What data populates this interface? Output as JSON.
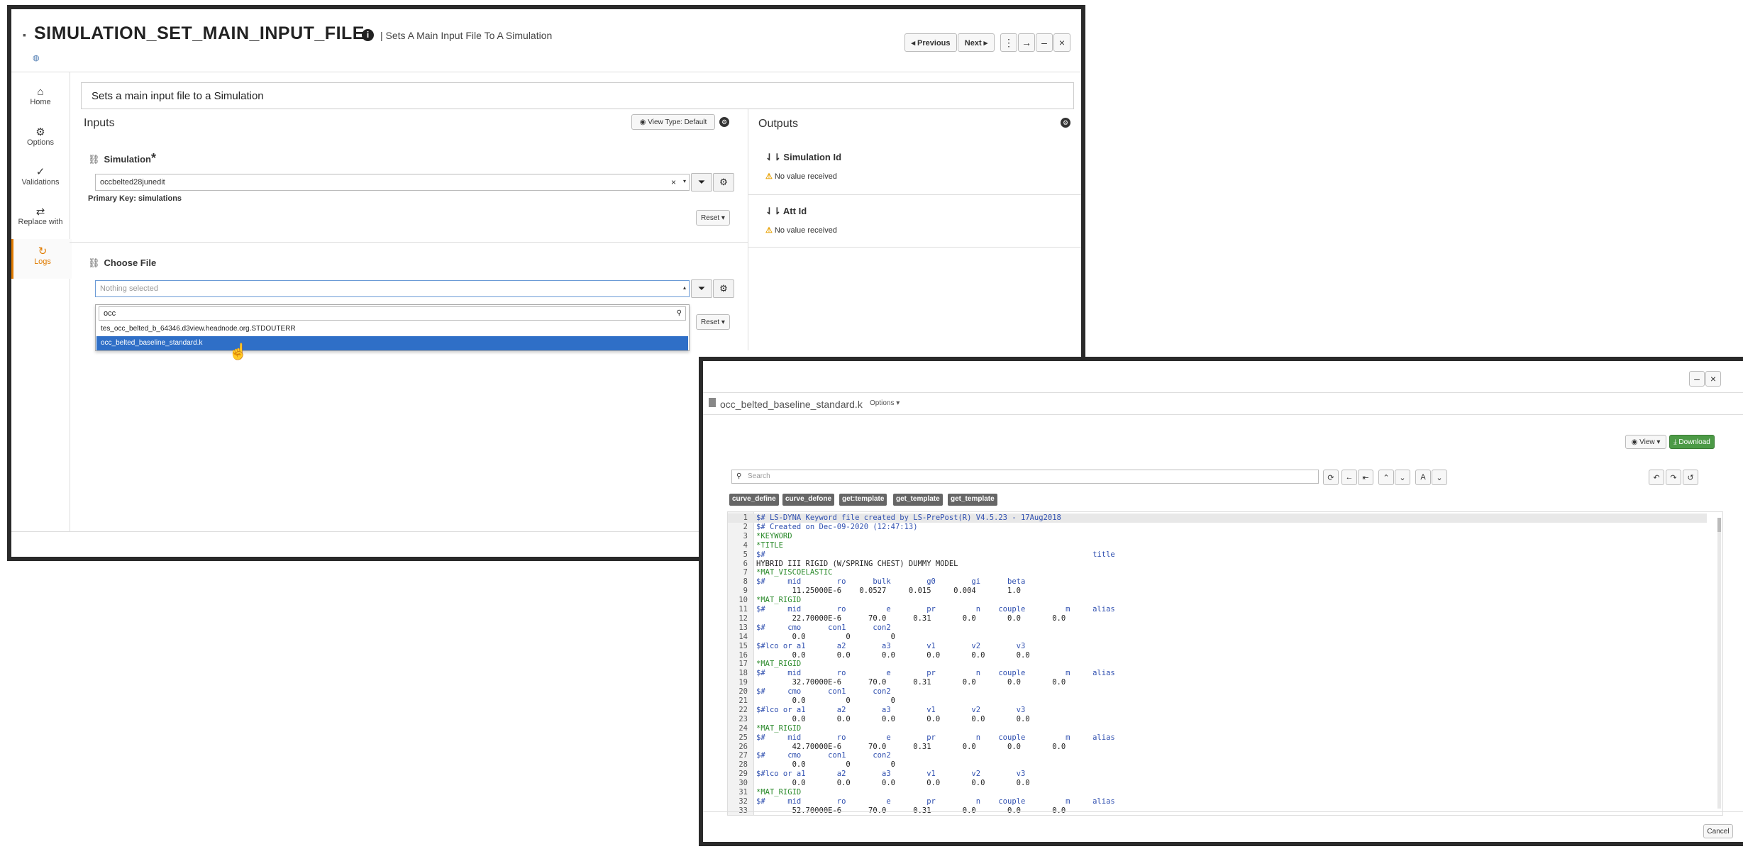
{
  "main_window": {
    "title": "SIMULATION_SET_MAIN_INPUT_FILE",
    "info_icon": "i",
    "subtitle": "| Sets A Main Input File To A Simulation",
    "nav": {
      "previous": "◂ Previous",
      "next": "Next ▸"
    },
    "window_controls": {
      "more": "⋮",
      "forward": "→",
      "minimize": "–",
      "close": "×"
    },
    "sidebar": [
      {
        "icon": "⌂",
        "label": "Home"
      },
      {
        "icon": "⚙",
        "label": "Options"
      },
      {
        "icon": "✓",
        "label": "Validations"
      },
      {
        "icon": "⇄",
        "label": "Replace with"
      },
      {
        "icon": "↻",
        "label": "Logs"
      }
    ],
    "description": "Sets a main input file to a Simulation",
    "inputs": {
      "title": "Inputs",
      "view_type": "View Type: Default",
      "simulation": {
        "label": "Simulation",
        "required": "*",
        "value": "occbelted28junedit",
        "primary_key": "Primary Key: simulations",
        "reset": "Reset ▾"
      },
      "choose_file": {
        "label": "Choose File",
        "placeholder": "Nothing selected",
        "search_value": "occ",
        "options": [
          "tes_occ_belted_b_64346.d3view.headnode.org.STDOUTERR",
          "occ_belted_baseline_standard.k"
        ],
        "selected_index": 1,
        "reset": "Reset ▾"
      }
    },
    "outputs": {
      "title": "Outputs",
      "items": [
        {
          "label": "Simulation Id",
          "status": "No value received"
        },
        {
          "label": "Att Id",
          "status": "No value received"
        }
      ]
    }
  },
  "file_viewer": {
    "filename": "occ_belted_baseline_standard.k",
    "options_label": "Options ▾",
    "view_label": "View ▾",
    "download_label": "Download",
    "search_placeholder": "Search",
    "tags": [
      "curve_define",
      "curve_defone",
      "get:template",
      "get_template",
      "get_template"
    ],
    "cancel_label": "Cancel",
    "code_lines": [
      "$# LS-DYNA Keyword file created by LS-PrePost(R) V4.5.23 - 17Aug2018",
      "$# Created on Dec-09-2020 (12:47:13)",
      "*KEYWORD",
      "*TITLE",
      "$#                                                                         title",
      "HYBRID III RIGID (W/SPRING CHEST) DUMMY MODEL",
      "*MAT_VISCOELASTIC",
      "$#     mid        ro      bulk        g0        gi      beta",
      "        11.25000E-6    0.0527     0.015     0.004       1.0",
      "*MAT_RIGID",
      "$#     mid        ro         e        pr         n    couple         m     alias",
      "        22.70000E-6      70.0      0.31       0.0       0.0       0.0",
      "$#     cmo      con1      con2",
      "        0.0         0         0",
      "$#lco or a1       a2        a3        v1        v2        v3",
      "        0.0       0.0       0.0       0.0       0.0       0.0",
      "*MAT_RIGID",
      "$#     mid        ro         e        pr         n    couple         m     alias",
      "        32.70000E-6      70.0      0.31       0.0       0.0       0.0",
      "$#     cmo      con1      con2",
      "        0.0         0         0",
      "$#lco or a1       a2        a3        v1        v2        v3",
      "        0.0       0.0       0.0       0.0       0.0       0.0",
      "*MAT_RIGID",
      "$#     mid        ro         e        pr         n    couple         m     alias",
      "        42.70000E-6      70.0      0.31       0.0       0.0       0.0",
      "$#     cmo      con1      con2",
      "        0.0         0         0",
      "$#lco or a1       a2        a3        v1        v2        v3",
      "        0.0       0.0       0.0       0.0       0.0       0.0",
      "*MAT_RIGID",
      "$#     mid        ro         e        pr         n    couple         m     alias",
      "        52.70000E-6      70.0      0.31       0.0       0.0       0.0"
    ]
  },
  "colors": {
    "accent": "#e07b00",
    "selected": "#2f6fc7",
    "download": "#4c9a46",
    "warning": "#e8a000"
  }
}
